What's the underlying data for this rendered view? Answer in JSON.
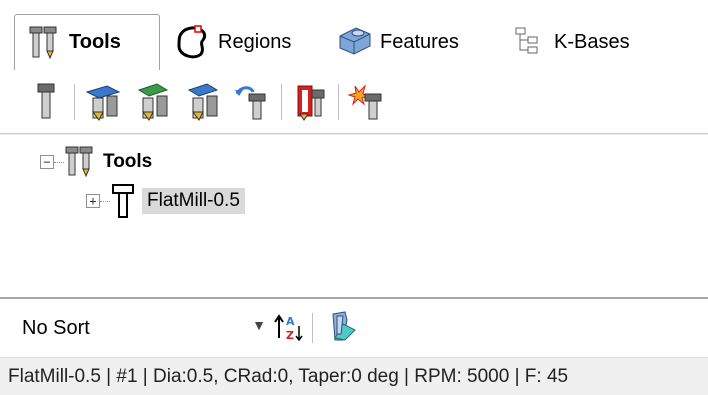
{
  "tabs": [
    {
      "label": "Tools",
      "icon": "tools-icon",
      "active": true
    },
    {
      "label": "Regions",
      "icon": "regions-icon",
      "active": false
    },
    {
      "label": "Features",
      "icon": "features-icon",
      "active": false
    },
    {
      "label": "K-Bases",
      "icon": "kbases-icon",
      "active": false
    }
  ],
  "toolbar": {
    "buttons": [
      "new-tool-icon",
      "tool-library-icon",
      "import-tool-icon",
      "export-tool-icon",
      "undo-tool-icon",
      "delete-tool-icon",
      "clear-tools-icon"
    ]
  },
  "tree": {
    "root_label": "Tools",
    "root_expander": "−",
    "child_label": "FlatMill-0.5",
    "child_expander": "+"
  },
  "sort": {
    "selected": "No Sort",
    "dropdown_arrow": "▼"
  },
  "status": {
    "text": "FlatMill-0.5 | #1 | Dia:0.5, CRad:0, Taper:0 deg | RPM: 5000 | F: 45"
  },
  "colors": {
    "accent_blue": "#3a78c9",
    "tool_gray": "#6b6b6b",
    "delete_red": "#d42020",
    "selection": "#d9d9d9"
  }
}
